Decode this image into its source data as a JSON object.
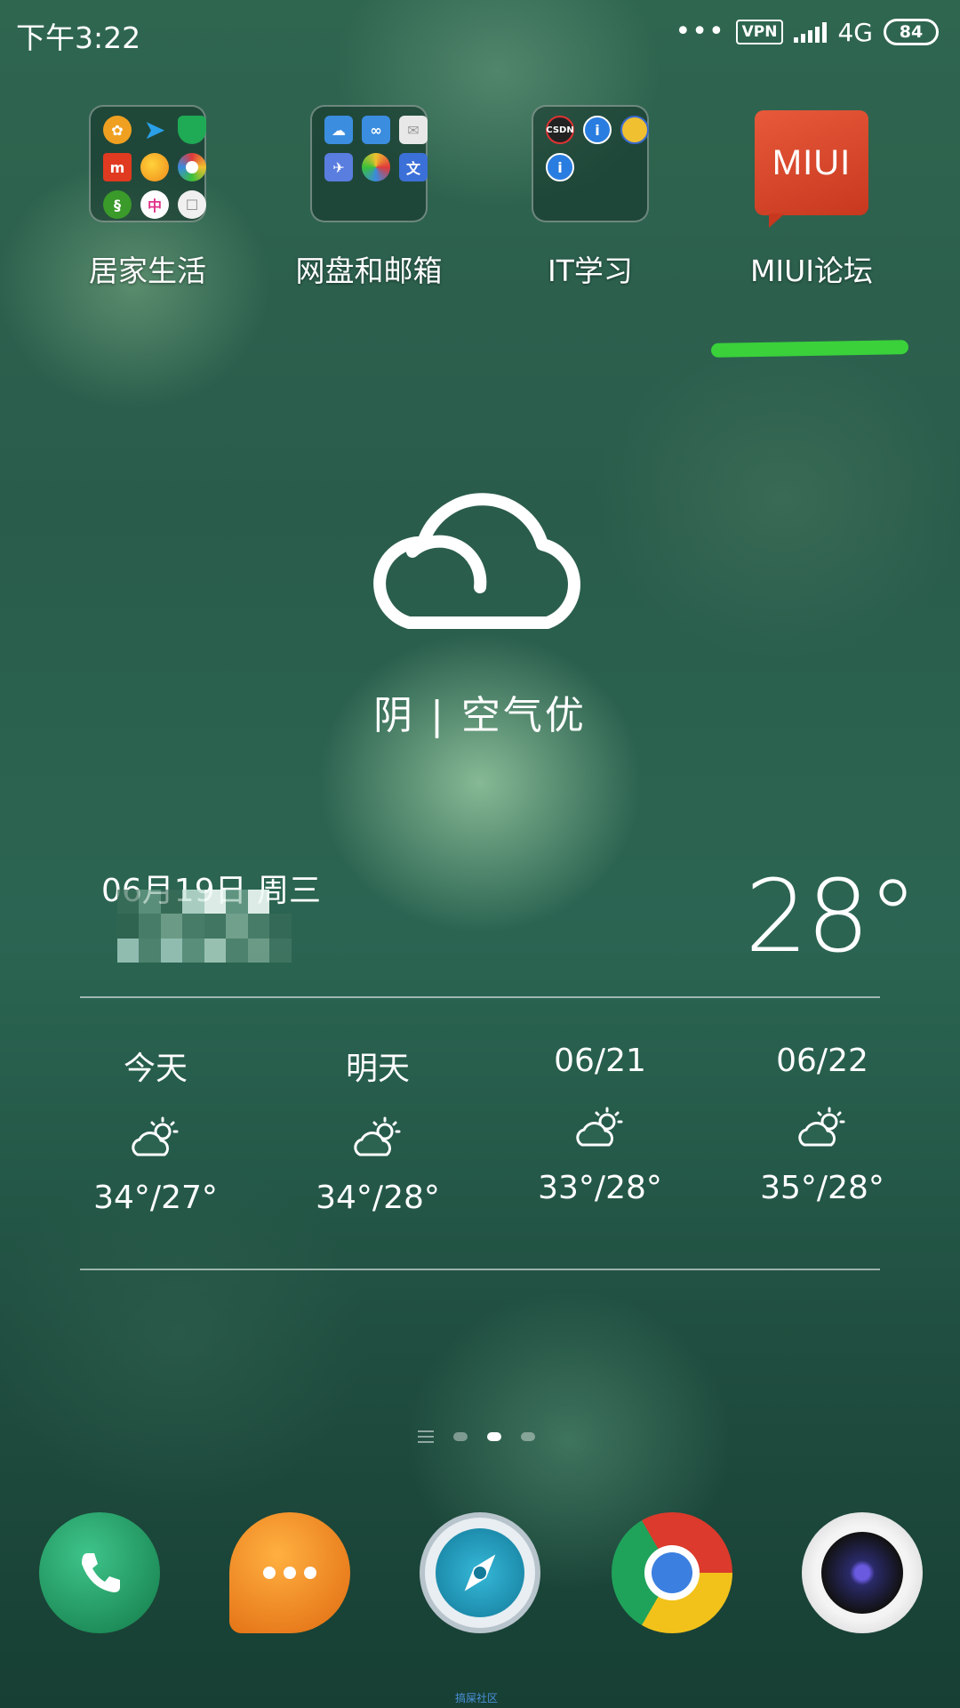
{
  "status_bar": {
    "time": "下午3:22",
    "dots": "•••",
    "vpn": "VPN",
    "network": "4G",
    "battery": "84"
  },
  "apps": [
    {
      "label": "居家生活",
      "type": "folder",
      "icon": "folder-icon"
    },
    {
      "label": "网盘和邮箱",
      "type": "folder",
      "icon": "folder-icon"
    },
    {
      "label": "IT学习",
      "type": "folder",
      "icon": "folder-icon"
    },
    {
      "label": "MIUI论坛",
      "type": "app",
      "icon": "miui-forum-icon",
      "icon_text": "MIUI"
    }
  ],
  "folder_contents": {
    "home_life": [
      {
        "icon": "china-mobile-icon",
        "color": "#f0a020"
      },
      {
        "icon": "send-icon",
        "color": "#2aa0e8"
      },
      {
        "icon": "shield-icon",
        "color": "#1faa55"
      },
      {
        "icon": "mi-icon",
        "color": "#e03a20"
      },
      {
        "icon": "weather-icon",
        "color": "#f5a623"
      },
      {
        "icon": "color-ring-icon",
        "color": "#e8e8e8"
      },
      {
        "icon": "green-app-icon",
        "color": "#3a9a2a"
      },
      {
        "icon": "pink-app-icon",
        "color": "#e0338a"
      },
      {
        "icon": "white-app-icon",
        "color": "#f0f0f0"
      }
    ],
    "cloud_mail": [
      {
        "icon": "cloud-drive-icon",
        "color": "#3b8de0"
      },
      {
        "icon": "cloud-sync-icon",
        "color": "#3b8de0"
      },
      {
        "icon": "mail-icon",
        "color": "#e8e8e8"
      },
      {
        "icon": "bird-icon",
        "color": "#5a7de0"
      },
      {
        "icon": "photos-icon",
        "color": "#f0c030"
      },
      {
        "icon": "text-icon",
        "color": "#3b70d8"
      }
    ],
    "it_learning": [
      {
        "icon": "csdn-icon",
        "color": "#222222"
      },
      {
        "icon": "info-icon",
        "color": "#2a7de0"
      },
      {
        "icon": "python-icon",
        "color": "#f0c030"
      },
      {
        "icon": "info-icon",
        "color": "#2a7de0"
      }
    ]
  },
  "weather": {
    "description": "阴 | 空气优",
    "date": "06月19日 周三",
    "current_temp": "28°",
    "forecast": [
      {
        "label": "今天",
        "temp": "34°/27°"
      },
      {
        "label": "明天",
        "temp": "34°/28°"
      },
      {
        "label": "06/21",
        "temp": "33°/28°"
      },
      {
        "label": "06/22",
        "temp": "35°/28°"
      }
    ]
  },
  "page_indicator": {
    "total": 3,
    "active_index": 1
  },
  "dock": [
    {
      "icon": "phone-icon",
      "color": "#1e9a5e"
    },
    {
      "icon": "messages-icon",
      "color": "#f08a1a"
    },
    {
      "icon": "browser-icon",
      "color": "#1a8fb8"
    },
    {
      "icon": "chrome-icon",
      "color": "#d83a2a"
    },
    {
      "icon": "camera-icon",
      "color": "#2a2a6a"
    }
  ],
  "watermark": "搞屎社区"
}
